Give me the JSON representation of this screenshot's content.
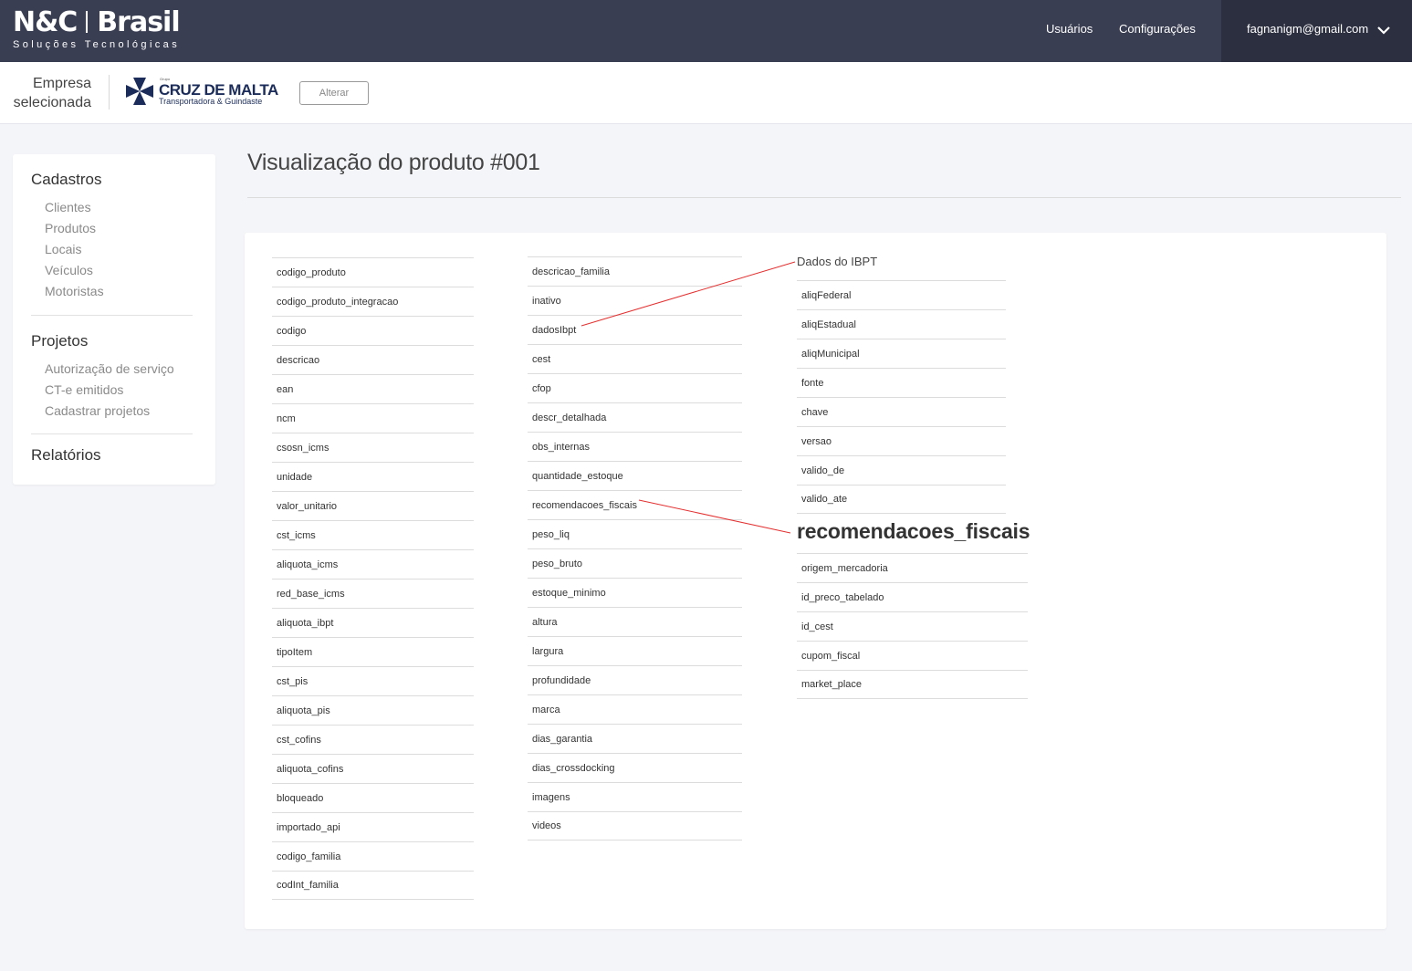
{
  "brand": {
    "name_left": "N&C",
    "name_right": "Brasil",
    "subtitle": "Soluções Tecnológicas"
  },
  "topnav": {
    "users": "Usuários",
    "settings": "Configurações",
    "user_email": "fagnanigm@gmail.com"
  },
  "company": {
    "label": "Empresa selecionada",
    "logo_small": "Grupo",
    "logo_main": "CRUZ DE MALTA",
    "logo_tagline": "Transportadora & Guindaste",
    "change_button": "Alterar"
  },
  "sidebar": {
    "sections": [
      {
        "title": "Cadastros",
        "items": [
          "Clientes",
          "Produtos",
          "Locais",
          "Veículos",
          "Motoristas"
        ]
      },
      {
        "title": "Projetos",
        "items": [
          "Autorização de serviço",
          "CT-e emitidos",
          "Cadastrar projetos"
        ]
      },
      {
        "title": "Relatórios",
        "items": []
      }
    ]
  },
  "page": {
    "title": "Visualização do produto #001"
  },
  "fields": {
    "column1": [
      "codigo_produto",
      "codigo_produto_integracao",
      "codigo",
      "descricao",
      "ean",
      "ncm",
      "csosn_icms",
      "unidade",
      "valor_unitario",
      "cst_icms",
      "aliquota_icms",
      "red_base_icms",
      "aliquota_ibpt",
      "tipoItem",
      "cst_pis",
      "aliquota_pis",
      "cst_cofins",
      "aliquota_cofins",
      "bloqueado",
      "importado_api",
      "codigo_familia",
      "codInt_familia"
    ],
    "column2": [
      "descricao_familia",
      "inativo",
      "dadosIbpt",
      "cest",
      "cfop",
      "descr_detalhada",
      "obs_internas",
      "quantidade_estoque",
      "recomendacoes_fiscais",
      "peso_liq",
      "peso_bruto",
      "estoque_minimo",
      "altura",
      "largura",
      "profundidade",
      "marca",
      "dias_garantia",
      "dias_crossdocking",
      "imagens",
      "videos"
    ]
  },
  "groups": {
    "ibpt": {
      "title": "Dados do IBPT",
      "items": [
        "aliqFederal",
        "aliqEstadual",
        "aliqMunicipal",
        "fonte",
        "chave",
        "versao",
        "valido_de",
        "valido_ate"
      ]
    },
    "recomendacoes": {
      "title": "recomendacoes_fiscais",
      "items": [
        "origem_mercadoria",
        "id_preco_tabelado",
        "id_cest",
        "cupom_fiscal",
        "market_place"
      ]
    }
  },
  "colors": {
    "topbar": "#3a3e52",
    "user_box": "#2c2f40",
    "connector": "#e53030",
    "background": "#f4f5f9"
  }
}
